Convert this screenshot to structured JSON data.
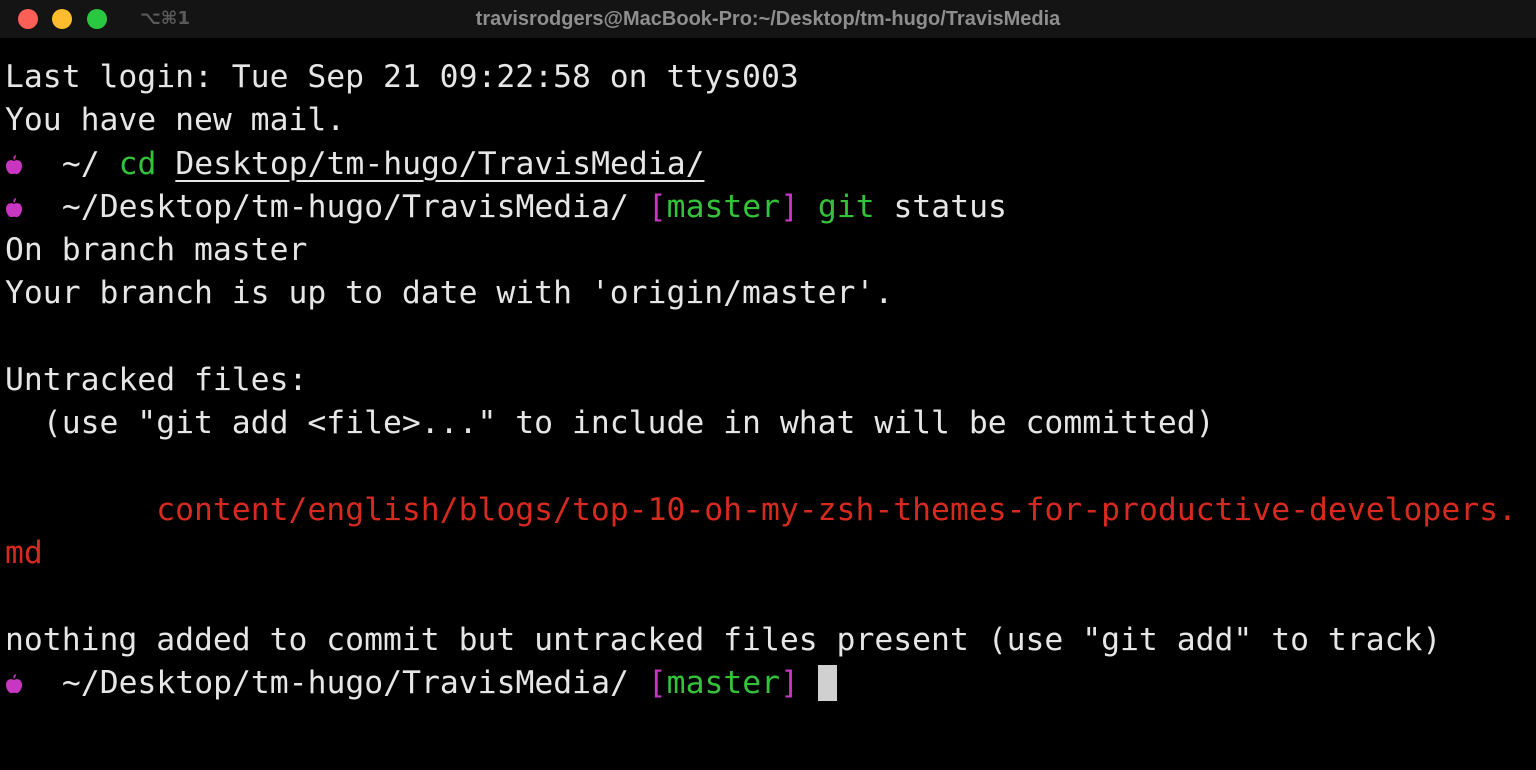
{
  "window": {
    "title": "travisrodgers@MacBook-Pro:~/Desktop/tm-hugo/TravisMedia",
    "shortcut": "⌥⌘1"
  },
  "colors": {
    "background": "#000000",
    "text": "#e6e6e6",
    "prompt_icon": "#c836c2",
    "command": "#33c23a",
    "untracked_file": "#d62a1e"
  },
  "icons": {
    "prompt": "apple-icon"
  },
  "terminal": {
    "last_login": "Last login: Tue Sep 21 09:22:58 on ttys003",
    "mail": "You have new mail.",
    "prompt1": {
      "dir": " ~/ ",
      "cmd": "cd",
      "arg": "Desktop/tm-hugo/TravisMedia/"
    },
    "prompt2": {
      "dir": " ~/Desktop/tm-hugo/TravisMedia/ ",
      "bracket_open": "[",
      "branch": "master",
      "bracket_close": "]",
      "cmd": "git",
      "arg": " status"
    },
    "on_branch": "On branch master",
    "up_to_date": "Your branch is up to date with 'origin/master'.",
    "untracked_header": "Untracked files:",
    "untracked_hint": "  (use \"git add <file>...\" to include in what will be committed)",
    "untracked_file_part1": "content/english/blogs/top-10-oh-my-zsh-themes-for-productive-developers.",
    "untracked_file_part2": "md",
    "nothing_added": "nothing added to commit but untracked files present (use \"git add\" to track)",
    "prompt3": {
      "dir": " ~/Desktop/tm-hugo/TravisMedia/ ",
      "bracket_open": "[",
      "branch": "master",
      "bracket_close": "]"
    }
  }
}
